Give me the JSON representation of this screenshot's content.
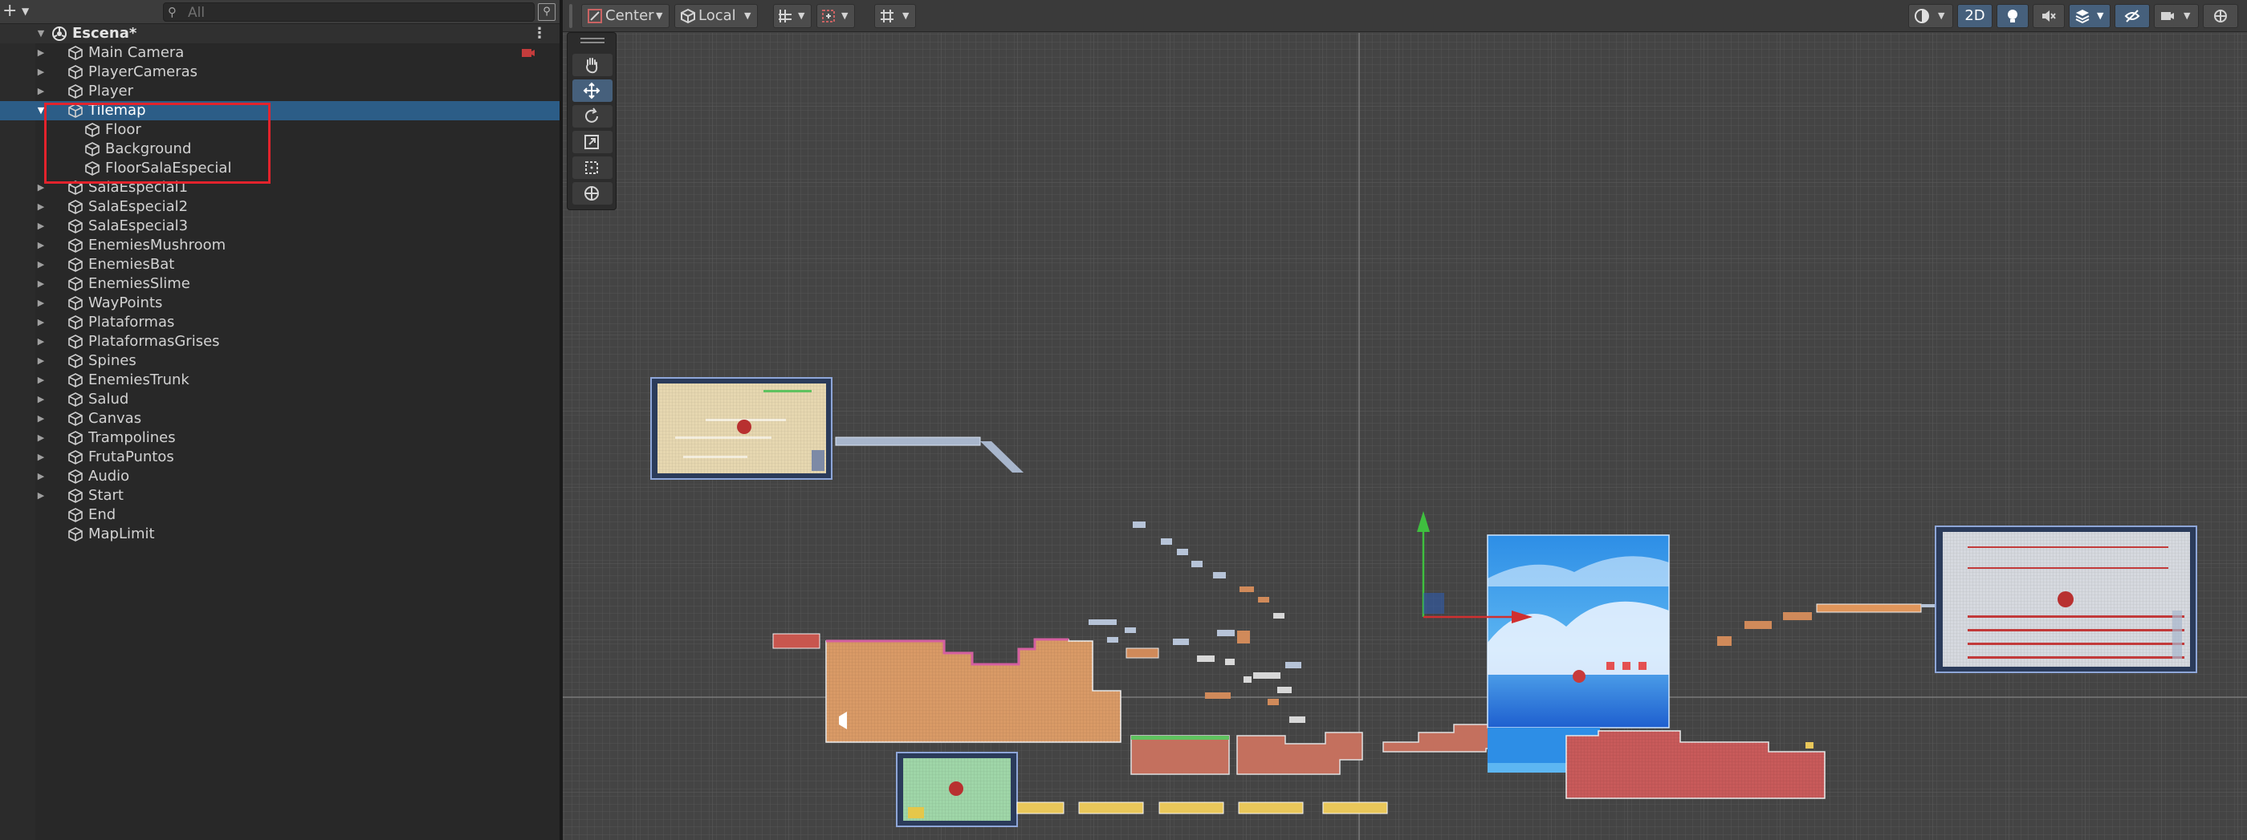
{
  "hierarchy": {
    "search_placeholder": "All",
    "scene": {
      "name": "Escena*"
    },
    "items": [
      {
        "label": "Main Camera",
        "expand": "collapsed",
        "depth": 0
      },
      {
        "label": "PlayerCameras",
        "expand": "collapsed",
        "depth": 0
      },
      {
        "label": "Player",
        "expand": "collapsed",
        "depth": 0
      },
      {
        "label": "Tilemap",
        "expand": "expanded",
        "depth": 0,
        "selected": true
      },
      {
        "label": "Floor",
        "expand": "none",
        "depth": 1
      },
      {
        "label": "Background",
        "expand": "none",
        "depth": 1
      },
      {
        "label": "FloorSalaEspecial",
        "expand": "none",
        "depth": 1
      },
      {
        "label": "SalaEspecial1",
        "expand": "collapsed",
        "depth": 0
      },
      {
        "label": "SalaEspecial2",
        "expand": "collapsed",
        "depth": 0
      },
      {
        "label": "SalaEspecial3",
        "expand": "collapsed",
        "depth": 0
      },
      {
        "label": "EnemiesMushroom",
        "expand": "collapsed",
        "depth": 0
      },
      {
        "label": "EnemiesBat",
        "expand": "collapsed",
        "depth": 0
      },
      {
        "label": "EnemiesSlime",
        "expand": "collapsed",
        "depth": 0
      },
      {
        "label": "WayPoints",
        "expand": "collapsed",
        "depth": 0
      },
      {
        "label": "Plataformas",
        "expand": "collapsed",
        "depth": 0
      },
      {
        "label": "PlataformasGrises",
        "expand": "collapsed",
        "depth": 0
      },
      {
        "label": "Spines",
        "expand": "collapsed",
        "depth": 0
      },
      {
        "label": "EnemiesTrunk",
        "expand": "collapsed",
        "depth": 0
      },
      {
        "label": "Salud",
        "expand": "collapsed",
        "depth": 0
      },
      {
        "label": "Canvas",
        "expand": "collapsed",
        "depth": 0
      },
      {
        "label": "Trampolines",
        "expand": "collapsed",
        "depth": 0
      },
      {
        "label": "FrutaPuntos",
        "expand": "collapsed",
        "depth": 0
      },
      {
        "label": "Audio",
        "expand": "collapsed",
        "depth": 0
      },
      {
        "label": "Start",
        "expand": "collapsed",
        "depth": 0
      },
      {
        "label": "End",
        "expand": "none",
        "depth": 0
      },
      {
        "label": "MapLimit",
        "expand": "none",
        "depth": 0
      }
    ]
  },
  "scene_view": {
    "pivot_mode": "Center",
    "pivot_rotation": "Local",
    "mode_2d_label": "2D",
    "tools": [
      "hand-tool",
      "move-tool",
      "rotate-tool",
      "scale-tool",
      "rect-tool",
      "transform-tool"
    ],
    "active_tool": "move-tool",
    "colors": {
      "selection_blue": "#2c5d87",
      "highlight_red": "#e3232c",
      "axis_y_green": "#3fbf3f",
      "axis_x_red": "#d03030",
      "grid_bg": "#444444"
    }
  }
}
